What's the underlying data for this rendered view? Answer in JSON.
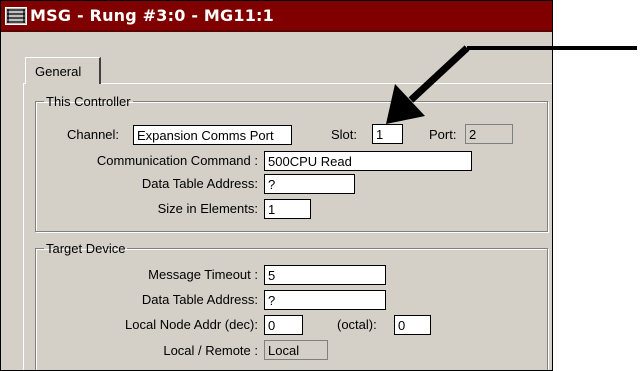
{
  "window": {
    "title": "MSG - Rung #3:0 - MG11:1",
    "icon": "ladder-logic-icon"
  },
  "tabs": [
    {
      "label": "General",
      "active": true
    }
  ],
  "this_controller": {
    "legend": "This Controller",
    "channel_label": "Channel:",
    "channel_value": "Expansion Comms Port",
    "slot_label": "Slot:",
    "slot_value": "1",
    "port_label": "Port:",
    "port_value": "2",
    "comm_command_label": "Communication Command :",
    "comm_command_value": "500CPU Read",
    "data_table_label": "Data Table Address:",
    "data_table_value": "?",
    "size_label": "Size in Elements:",
    "size_value": "1"
  },
  "target_device": {
    "legend": "Target Device",
    "timeout_label": "Message Timeout :",
    "timeout_value": "5",
    "data_table_label": "Data Table Address:",
    "data_table_value": "?",
    "node_label": "Local Node Addr (dec):",
    "node_value": "0",
    "octal_label": "(octal):",
    "octal_value": "0",
    "local_remote_label": "Local / Remote :",
    "local_remote_value": "Local"
  },
  "colors": {
    "titlebar": "#800000",
    "dialog": "#d4d0c8",
    "arrow": "#000000"
  }
}
